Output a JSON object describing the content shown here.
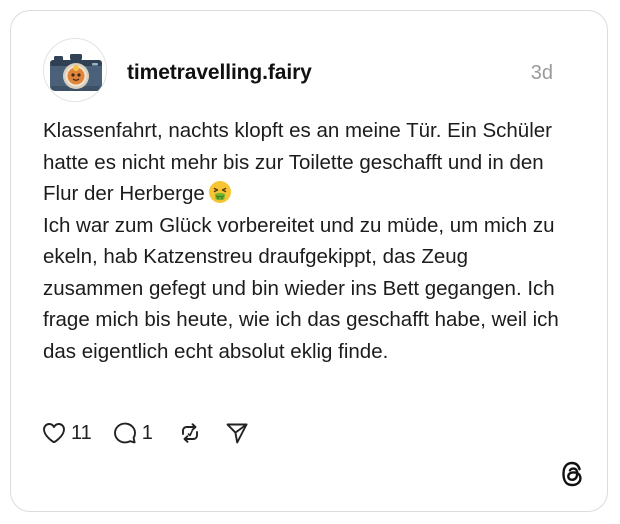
{
  "post": {
    "username": "timetravelling.fairy",
    "timestamp": "3d",
    "text_lines_1": "Klassenfahrt, nachts klopft es an meine Tür. Ein Schüler hatte es nicht mehr bis zur Toilette geschafft und in den Flur der Herberge",
    "emoji": "🤮",
    "emoji_icon": "face-vomiting-icon",
    "text_lines_2": "Ich war zum Glück vorbereitet und zu müde, um mich zu ekeln, hab Katzenstreu draufgekippt, das Zeug zusammen gefegt und bin wieder ins Bett gegangen. Ich frage mich bis heute, wie ich das geschafft habe, weil ich das eigentlich echt absolut eklig finde."
  },
  "actions": {
    "likes": "11",
    "replies": "1",
    "like_icon": "heart-icon",
    "reply_icon": "comment-icon",
    "repost_icon": "repost-icon",
    "share_icon": "send-icon"
  },
  "branding": {
    "logo_icon": "threads-logo-icon"
  }
}
